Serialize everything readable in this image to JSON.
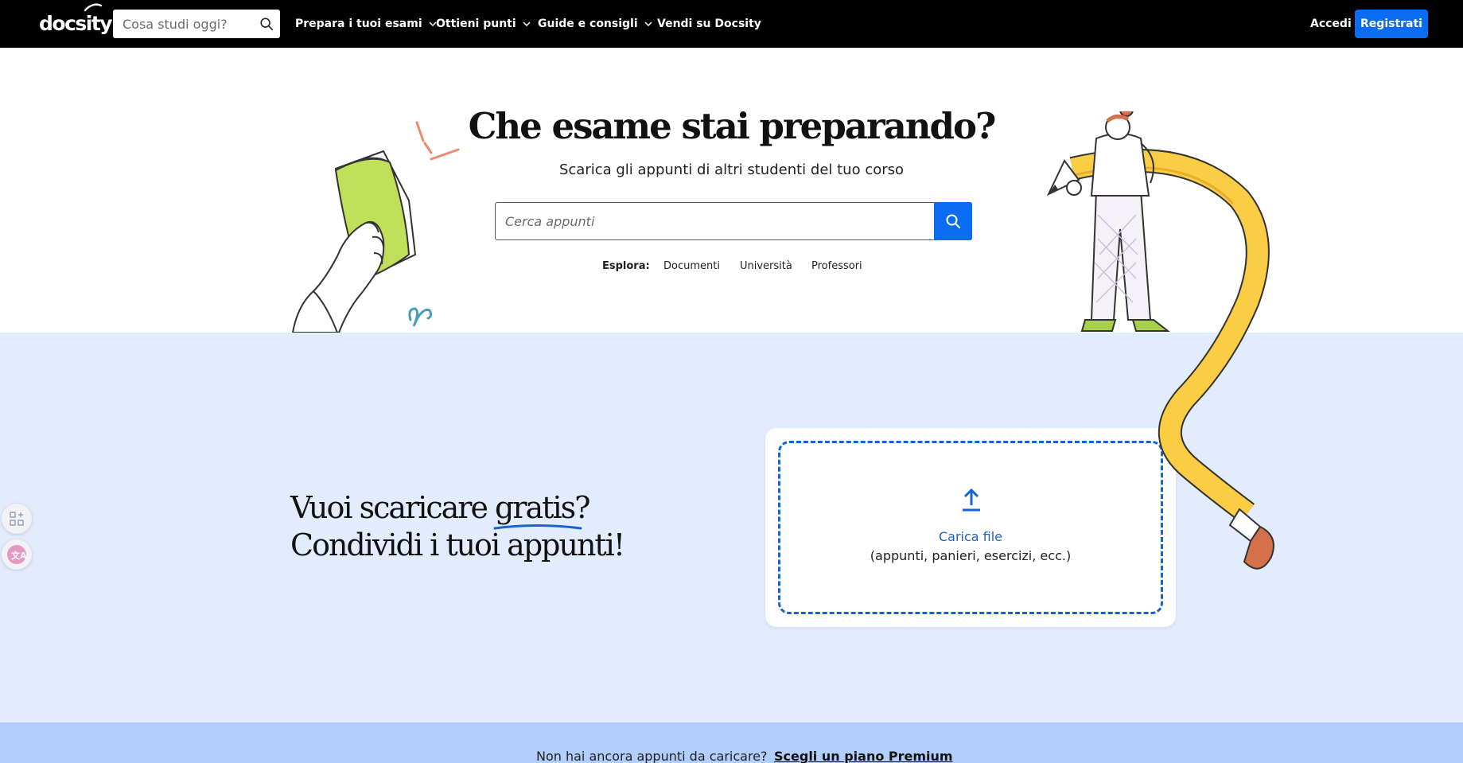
{
  "header": {
    "logo": "docsity",
    "search_placeholder": "Cosa studi oggi?",
    "nav": [
      {
        "label": "Prepara i tuoi esami",
        "has_dropdown": true
      },
      {
        "label": "Ottieni punti",
        "has_dropdown": true
      },
      {
        "label": "Guide e consigli",
        "has_dropdown": true
      },
      {
        "label": "Vendi su Docsity",
        "has_dropdown": false
      }
    ],
    "login_label": "Accedi",
    "signup_label": "Registrati"
  },
  "hero": {
    "title": "Che esame stai preparando?",
    "subtitle": "Scarica gli appunti di altri studenti del tuo corso",
    "search_placeholder": "Cerca appunti",
    "explore_label": "Esplora:",
    "explore_links": [
      "Documenti",
      "Università",
      "Professori"
    ]
  },
  "share": {
    "title_part1": "Vuoi scaricare ",
    "title_highlight": "gratis?",
    "title_line2": "Condividi i tuoi appunti!",
    "upload_label": "Carica file",
    "upload_hint": "(appunti, panieri, esercizi, ecc.)"
  },
  "band": {
    "text": "Non hai ancora appunti da caricare?",
    "link": "Scegli un piano Premium"
  },
  "colors": {
    "topbar": "#000000",
    "accent": "#0a6df1",
    "upload_blue": "#1763d4",
    "section_bg": "#e3ecfc",
    "band_bg": "#b1cefc",
    "notebook_green": "#c1e05a",
    "pencil_yellow": "#fbcd45"
  },
  "icons": [
    "search-icon",
    "chevron-down-icon",
    "upload-icon",
    "apps-icon",
    "translate-icon"
  ]
}
